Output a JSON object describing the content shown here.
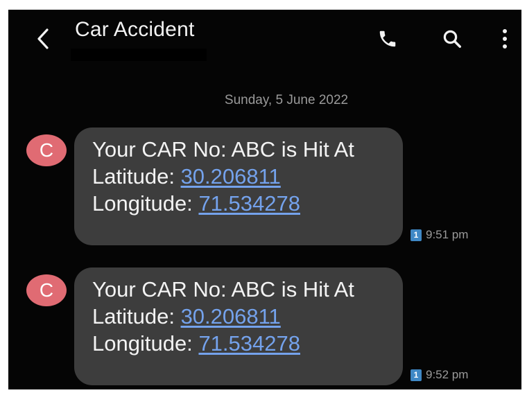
{
  "header": {
    "title": "Car Accident",
    "icons": {
      "back": "chevron-left-icon",
      "phone": "phone-icon",
      "search": "search-icon",
      "more": "more-vert-icon"
    }
  },
  "date_divider": "Sunday, 5 June 2022",
  "messages": [
    {
      "avatar_letter": "C",
      "line1": "Your CAR No: ABC is Hit At",
      "lat_label": "Latitude:",
      "lat_value": "30.206811",
      "lon_label": "Longitude:",
      "lon_value": "71.534278",
      "sim": "1",
      "time": "9:51 pm"
    },
    {
      "avatar_letter": "C",
      "line1": "Your CAR No: ABC is Hit At",
      "lat_label": "Latitude:",
      "lat_value": "30.206811",
      "lon_label": "Longitude:",
      "lon_value": "71.534278",
      "sim": "1",
      "time": "9:52 pm"
    }
  ],
  "colors": {
    "background": "#050505",
    "bubble": "#3d3d3d",
    "avatar": "#e06b73",
    "link": "#74a2ec",
    "sim_badge": "#3f88c5"
  }
}
